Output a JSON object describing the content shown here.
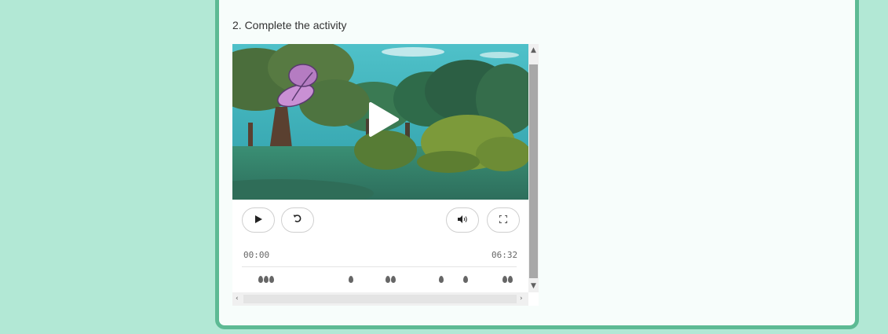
{
  "activity": {
    "title": "2. Complete the activity"
  },
  "player": {
    "current_time": "00:00",
    "duration": "06:32",
    "progress": 0,
    "buttons": {
      "play": "play-icon",
      "replay": "replay-icon",
      "volume": "volume-icon",
      "fullscreen": "fullscreen-icon"
    },
    "marker_groups": 6
  },
  "colors": {
    "page_background": "#b2e8d5",
    "card_border": "#5dba94",
    "card_background": "#f7fdfb",
    "scrollbar_thumb": "#a8a8a8"
  }
}
